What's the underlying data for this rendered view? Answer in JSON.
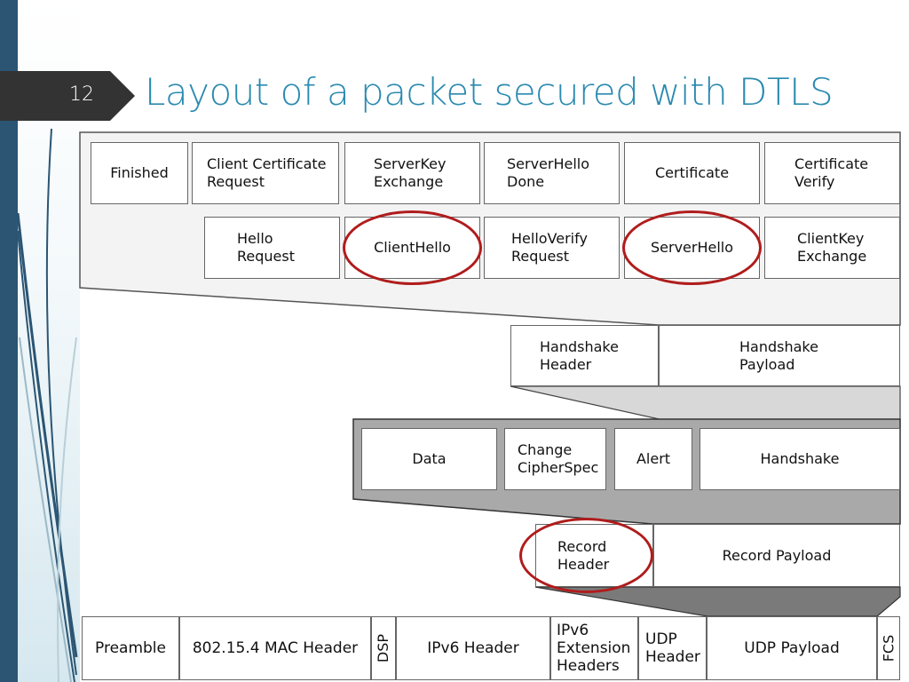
{
  "slide": {
    "number": "12",
    "title": "Layout of a packet secured with DTLS",
    "accent_color": "#2a8ab0",
    "sidebar_color": "#2b5573",
    "highlight_color": "#b01c1c"
  },
  "diagram": {
    "handshake_messages": {
      "row1": [
        {
          "label": "Finished"
        },
        {
          "label": "Client Certificate\nRequest"
        },
        {
          "label": "ServerKey\nExchange"
        },
        {
          "label": "ServerHello\nDone"
        },
        {
          "label": "Certificate"
        },
        {
          "label": "Certificate\nVerify"
        }
      ],
      "row2": [
        {
          "label": "Hello\nRequest"
        },
        {
          "label": "ClientHello",
          "highlighted": true
        },
        {
          "label": "HelloVerify\nRequest"
        },
        {
          "label": "ServerHello",
          "highlighted": true
        },
        {
          "label": "ClientKey\nExchange"
        }
      ]
    },
    "handshake_layer": [
      {
        "label": "Handshake\nHeader"
      },
      {
        "label": "Handshake\nPayload"
      }
    ],
    "record_content_types": [
      {
        "label": "Data"
      },
      {
        "label": "Change\nCipherSpec"
      },
      {
        "label": "Alert"
      },
      {
        "label": "Handshake"
      }
    ],
    "record_layer": [
      {
        "label": "Record\nHeader",
        "highlighted": true
      },
      {
        "label": "Record Payload"
      }
    ],
    "frame_layer": [
      {
        "label": "Preamble"
      },
      {
        "label": "802.15.4 MAC Header"
      },
      {
        "label": "DSP",
        "vertical": true
      },
      {
        "label": "IPv6 Header"
      },
      {
        "label": "IPv6\nExtension\nHeaders"
      },
      {
        "label": "UDP\nHeader"
      },
      {
        "label": "UDP Payload"
      },
      {
        "label": "FCS",
        "vertical": true
      }
    ]
  }
}
